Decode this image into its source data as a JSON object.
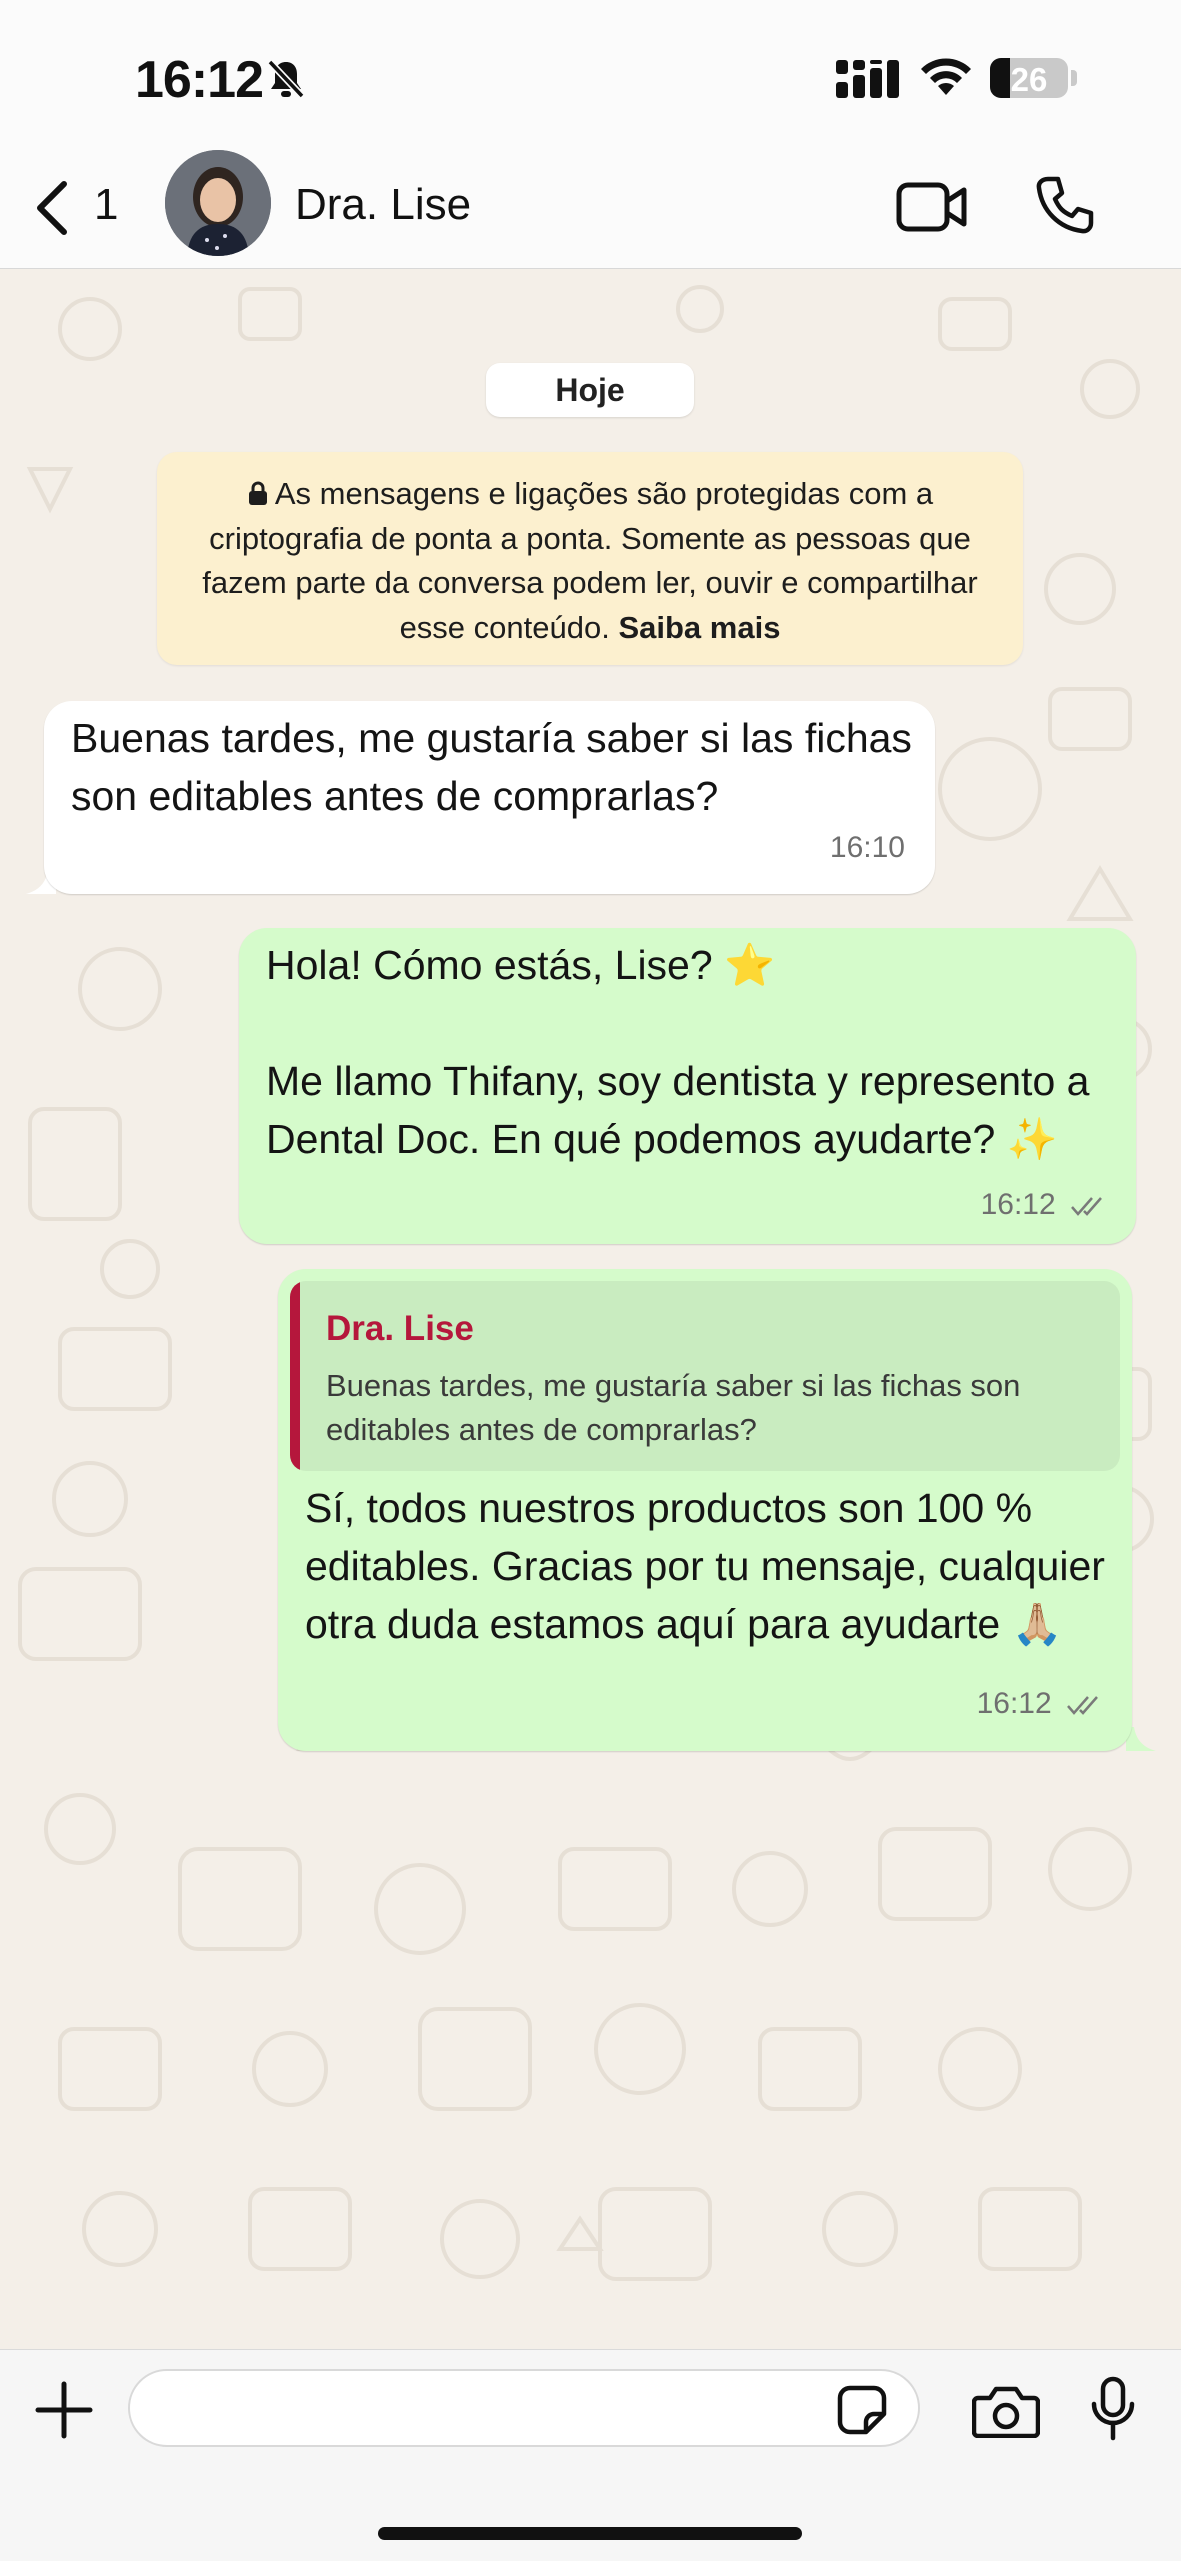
{
  "status_bar": {
    "time": "16:12",
    "battery": "26",
    "icons": [
      "bell-slash-icon",
      "cellular-signal-icon",
      "wifi-icon",
      "battery-icon"
    ]
  },
  "header": {
    "back_count": "1",
    "contact_name": "Dra. Lise",
    "icons": [
      "chevron-left-icon",
      "video-camera-icon",
      "phone-icon"
    ]
  },
  "chat": {
    "date_label": "Hoje",
    "encryption_notice": {
      "text": "As mensagens e ligações são protegidas com a criptografia de ponta a ponta. Somente as pessoas que fazem parte da conversa podem ler, ouvir e compartilhar esse conteúdo.",
      "link": "Saiba mais"
    },
    "messages": [
      {
        "direction": "incoming",
        "text": "Buenas tardes, me gustaría saber si las fichas son editables antes de comprarlas?",
        "time": "16:10"
      },
      {
        "direction": "outgoing",
        "text": "Hola! Cómo estás, Lise? ⭐\n\nMe llamo Thifany, soy dentista y represento a Dental Doc. En qué podemos ayudarte? ✨",
        "time": "16:12",
        "status": "read"
      },
      {
        "direction": "outgoing",
        "quote": {
          "author": "Dra. Lise",
          "text": "Buenas tardes, me gustaría saber si las fichas son editables antes de comprarlas?"
        },
        "text": "Sí, todos nuestros productos son 100 % editables. Gracias por tu mensaje, cualquier otra duda estamos aquí para ayudarte 🙏🏼",
        "time": "16:12",
        "status": "read"
      }
    ]
  },
  "input_bar": {
    "placeholder": "",
    "icons": [
      "plus-icon",
      "sticker-icon",
      "camera-icon",
      "microphone-icon"
    ]
  },
  "colors": {
    "incoming_bubble": "#ffffff",
    "outgoing_bubble": "#d5fbcb",
    "encryption_notice": "#fcf0cf",
    "quote_accent": "#b5173c",
    "chat_background": "#f4efe8"
  }
}
